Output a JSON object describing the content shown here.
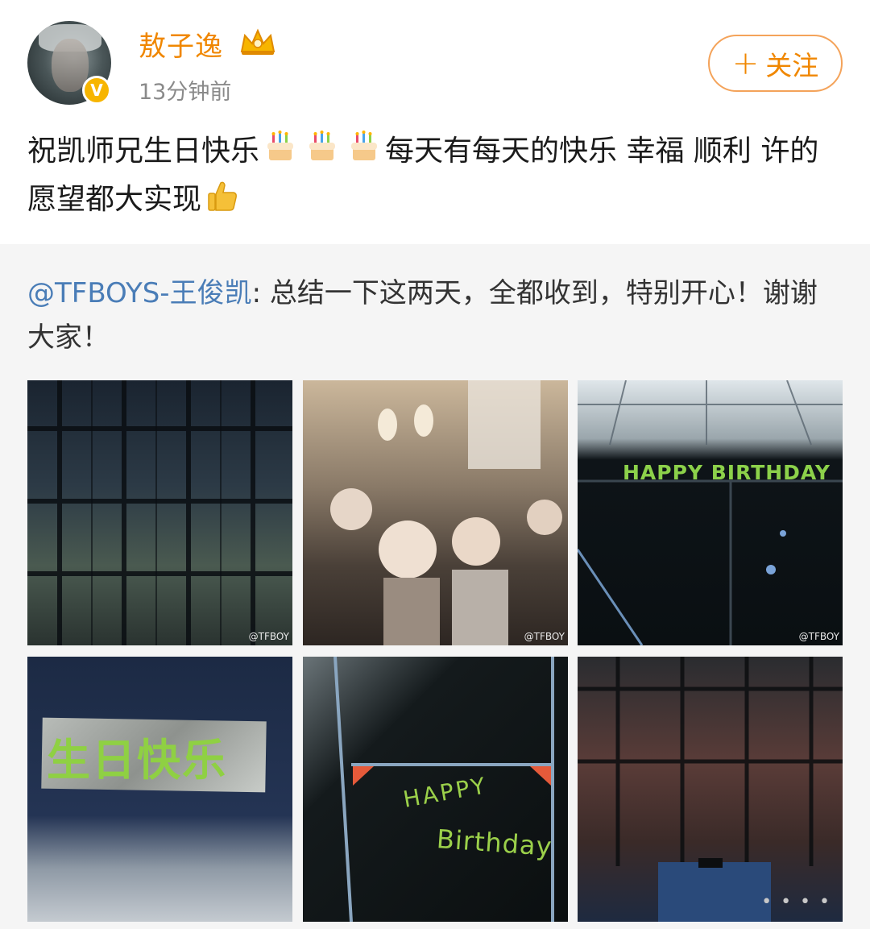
{
  "post": {
    "username": "敖子逸",
    "time": "13分钟前",
    "follow_label": "关注",
    "text_part1": "祝凯师兄生日快乐",
    "text_part2": "每天有每天的快乐 幸福 顺利 许的愿望都大实现",
    "emoji_icons": [
      "birthday-cake",
      "birthday-cake",
      "birthday-cake",
      "thumbs-up"
    ]
  },
  "repost": {
    "author": "@TFBOYS-王俊凯",
    "text": ": 总结一下这两天，全都收到，特别开心！谢谢大家！"
  },
  "photos": {
    "watermark": "@TFBOY",
    "photo3_banner": "HAPPY BIRTHDAY",
    "photo4_text": "生日快乐",
    "photo5_line1": "HAPPY",
    "photo5_line2": "Birthday"
  },
  "colors": {
    "username": "#f08700",
    "link": "#4a7db7",
    "repost_bg": "#f5f5f5",
    "verified": "#f7b500"
  }
}
